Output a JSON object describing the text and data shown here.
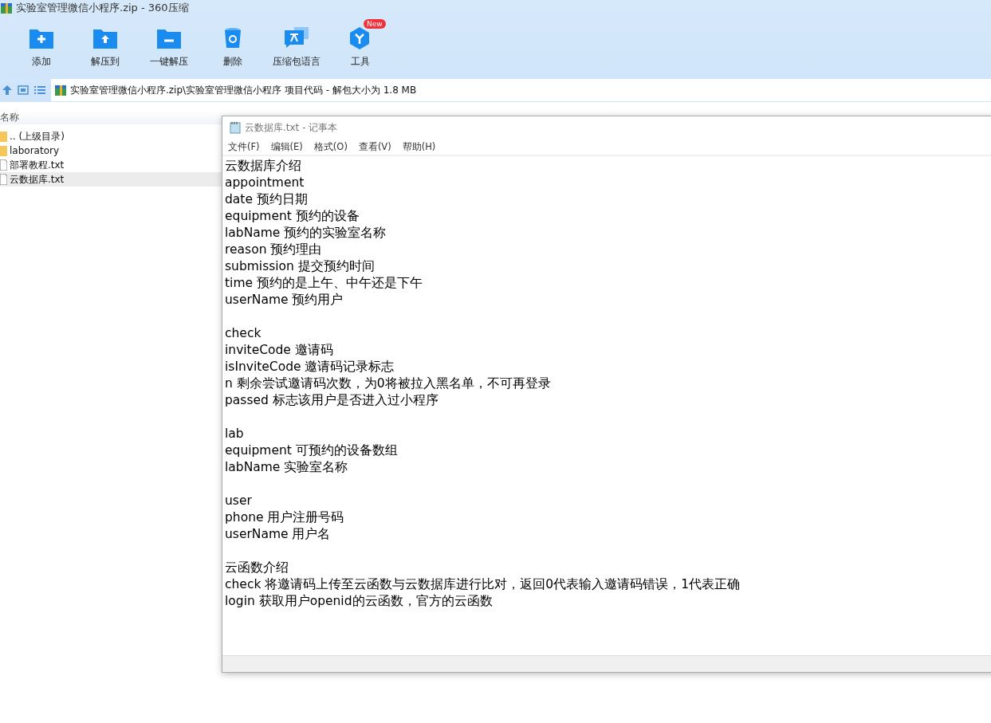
{
  "window": {
    "title": "实验室管理微信小程序.zip - 360压缩"
  },
  "toolbar": [
    {
      "label": "添加",
      "kind": "add"
    },
    {
      "label": "解压到",
      "kind": "extract"
    },
    {
      "label": "一键解压",
      "kind": "quick"
    },
    {
      "label": "删除",
      "kind": "delete"
    },
    {
      "label": "压缩包语言",
      "kind": "language"
    },
    {
      "label": "工具",
      "kind": "tools",
      "badge": "New"
    }
  ],
  "address": {
    "path": "实验室管理微信小程序.zip\\实验室管理微信小程序 项目代码 - 解包大小为 1.8 MB"
  },
  "file_list": {
    "column_1": "名称",
    "items": [
      {
        "name": ".. (上级目录)",
        "kind": "folder",
        "selected": false
      },
      {
        "name": "laboratory",
        "kind": "folder",
        "selected": false
      },
      {
        "name": "部署教程.txt",
        "kind": "file",
        "selected": false
      },
      {
        "name": "云数据库.txt",
        "kind": "file",
        "selected": true
      }
    ]
  },
  "notepad": {
    "title": "云数据库.txt - 记事本",
    "menu": [
      "文件(F)",
      "编辑(E)",
      "格式(O)",
      "查看(V)",
      "帮助(H)"
    ],
    "paragraphs": [
      [
        "云数据库介绍",
        "appointment",
        "date 预约日期",
        "equipment 预约的设备",
        "labName 预约的实验室名称",
        "reason 预约理由",
        "submission 提交预约时间",
        "time 预约的是上午、中午还是下午",
        "userName 预约用户"
      ],
      [
        "check",
        "inviteCode 邀请码",
        "isInviteCode 邀请码记录标志",
        "n 剩余尝试邀请码次数，为0将被拉入黑名单，不可再登录",
        "passed 标志该用户是否进入过小程序"
      ],
      [
        "lab",
        "equipment 可预约的设备数组",
        "labName 实验室名称"
      ],
      [
        "user",
        "phone 用户注册号码",
        "userName 用户名"
      ],
      [
        "云函数介绍",
        "check 将邀请码上传至云函数与云数据库进行比对，返回0代表输入邀请码错误，1代表正确",
        "login 获取用户openid的云函数，官方的云函数"
      ]
    ]
  }
}
